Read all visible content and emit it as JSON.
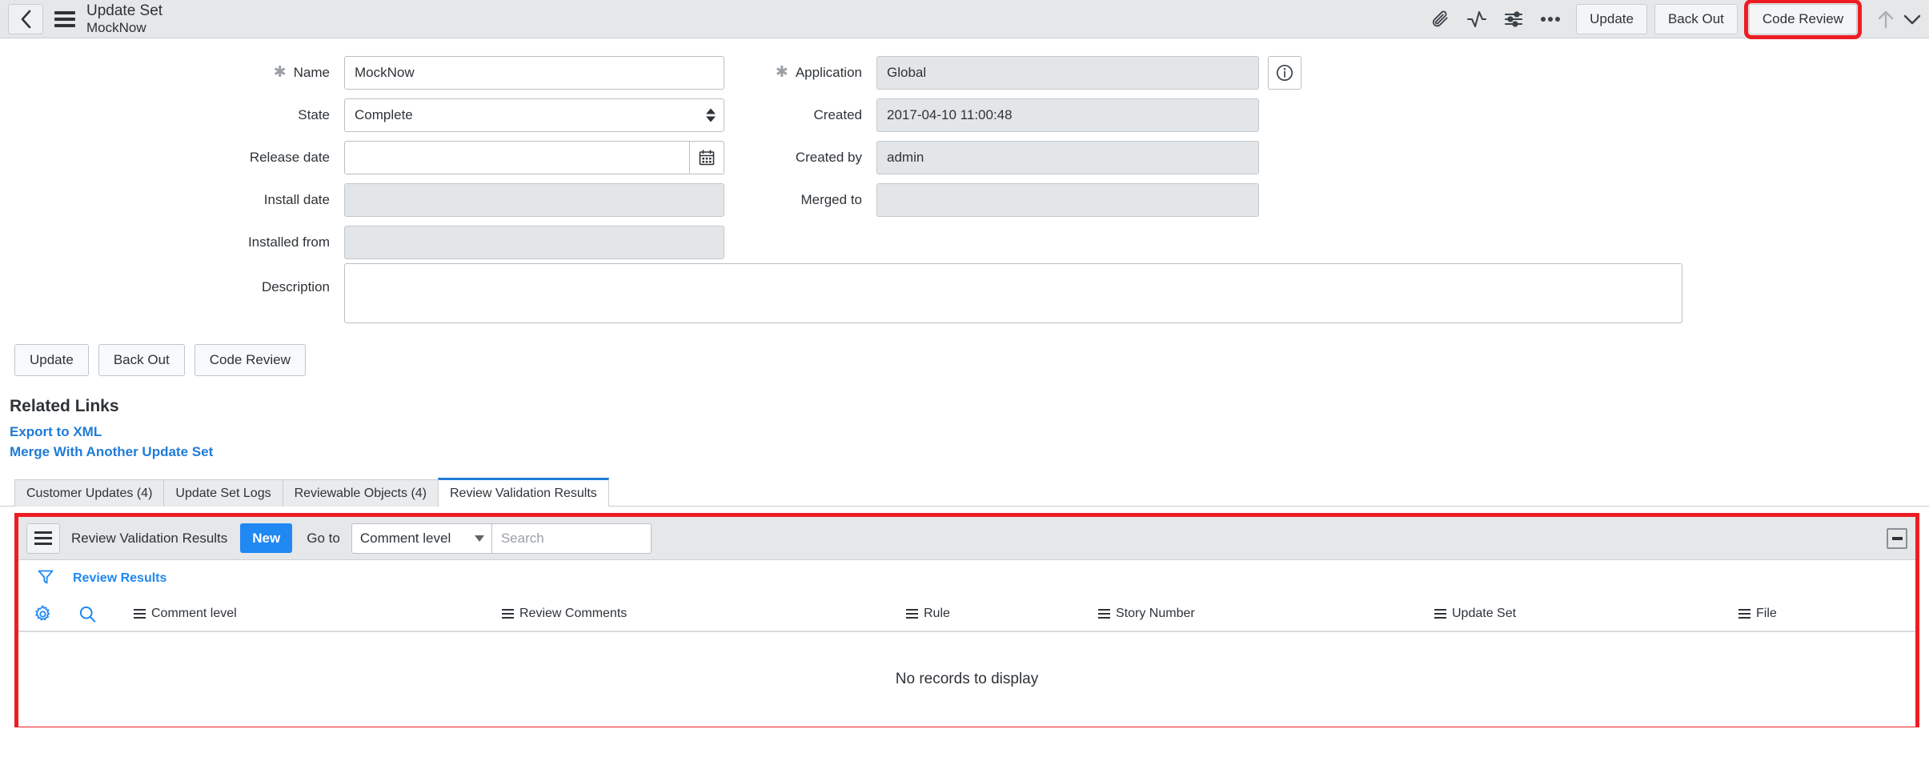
{
  "header": {
    "back_icon": "chevron-left-icon",
    "menu_icon": "hamburger-icon",
    "title": "Update Set",
    "subtitle": "MockNow",
    "icons": [
      {
        "name": "attachment-icon"
      },
      {
        "name": "activity-stream-icon"
      },
      {
        "name": "personalize-form-icon"
      },
      {
        "name": "more-options-icon"
      }
    ],
    "buttons": [
      {
        "label": "Update",
        "highlighted": false
      },
      {
        "label": "Back Out",
        "highlighted": false
      },
      {
        "label": "Code Review",
        "highlighted": true
      }
    ],
    "arrow_up_icon": "arrow-up-icon",
    "chevron_icon": "chevron-down-icon",
    "highlight_color": "#ee1d24"
  },
  "form": {
    "left": {
      "name": {
        "label": "Name",
        "value": "MockNow",
        "mandatory": true,
        "readonly": false
      },
      "state": {
        "label": "State",
        "value": "Complete",
        "options": [
          "Complete"
        ],
        "readonly": false
      },
      "release_date": {
        "label": "Release date",
        "value": "",
        "readonly": false,
        "picker_icon": "calendar-icon"
      },
      "install_date": {
        "label": "Install date",
        "value": "",
        "readonly": true
      },
      "installed_from": {
        "label": "Installed from",
        "value": "",
        "readonly": true
      }
    },
    "right": {
      "application": {
        "label": "Application",
        "value": "Global",
        "mandatory": true,
        "readonly": true,
        "info_icon": "info-icon"
      },
      "created": {
        "label": "Created",
        "value": "2017-04-10 11:00:48",
        "readonly": true
      },
      "created_by": {
        "label": "Created by",
        "value": "admin",
        "readonly": true
      },
      "merged_to": {
        "label": "Merged to",
        "value": "",
        "readonly": true
      }
    },
    "description": {
      "label": "Description",
      "value": ""
    }
  },
  "actions": [
    {
      "label": "Update"
    },
    {
      "label": "Back Out"
    },
    {
      "label": "Code Review"
    }
  ],
  "related_links": {
    "title": "Related Links",
    "links": [
      {
        "label": "Export to XML"
      },
      {
        "label": "Merge With Another Update Set"
      }
    ],
    "link_color": "#1f7bd6"
  },
  "tabs": [
    {
      "label": "Customer Updates (4)",
      "active": false
    },
    {
      "label": "Update Set Logs",
      "active": false
    },
    {
      "label": "Reviewable Objects (4)",
      "active": false
    },
    {
      "label": "Review Validation Results",
      "active": true
    }
  ],
  "list_panel": {
    "highlighted": true,
    "highlight_color": "#ee1d24",
    "menu_icon": "list-menu-icon",
    "title": "Review Validation Results",
    "new_button": "New",
    "new_button_color": "#1f88f2",
    "goto_label": "Go to",
    "goto_field": "Comment level",
    "search_placeholder": "Search",
    "search_value": "",
    "collapse_icon": "collapse-icon",
    "breadcrumb": {
      "filter_icon": "funnel-icon",
      "label": "Review Results"
    },
    "gear_icon": "gear-icon",
    "search_icon": "search-icon",
    "columns": [
      {
        "label": "Comment level"
      },
      {
        "label": "Review Comments"
      },
      {
        "label": "Rule"
      },
      {
        "label": "Story Number"
      },
      {
        "label": "Update Set"
      },
      {
        "label": "File"
      }
    ],
    "empty_message": "No records to display"
  }
}
